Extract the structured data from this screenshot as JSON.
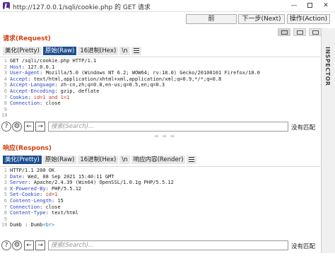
{
  "window": {
    "title": "http://127.0.0.1/sqli/cookie.php 的 GET 请求",
    "min_label": "—",
    "max_label": "",
    "close_label": "✕"
  },
  "nav": {
    "prev_label": "前",
    "next_label": "下一步(Next)",
    "action_label": "操作(Action)"
  },
  "inspector": {
    "label": "INSPECTOR"
  },
  "request": {
    "title": "请求(Request)",
    "tabs": [
      "美化(Pretty)",
      "原始(Raw)",
      "16进制(Hex)",
      "\\n"
    ],
    "active_tab": 1,
    "lines": [
      {
        "n": "1",
        "parts": [
          [
            "v",
            "GET /sqli/cookie.php HTTP/1.1"
          ]
        ]
      },
      {
        "n": "2",
        "parts": [
          [
            "k",
            "Host"
          ],
          [
            "v",
            ": 127.0.0.1"
          ]
        ]
      },
      {
        "n": "3",
        "parts": [
          [
            "k",
            "User-Agent"
          ],
          [
            "v",
            ": Mozilla/5.0 (Windows NT 6.2; WOW64; rv:18.0) Gecko/20100101 Firefox/18.0"
          ]
        ]
      },
      {
        "n": "4",
        "parts": [
          [
            "k",
            "Accept"
          ],
          [
            "v",
            ": text/html,application/xhtml+xml,application/xml;q=0.9,*/*;q=0.8"
          ]
        ]
      },
      {
        "n": "5",
        "parts": [
          [
            "k",
            "Accept-Language"
          ],
          [
            "v",
            ": zh-cn,zh;q=0.8,en-us;q=0.5,en;q=0.3"
          ]
        ]
      },
      {
        "n": "6",
        "parts": [
          [
            "k",
            "Accept-Encoding"
          ],
          [
            "v",
            ": gzip, deflate"
          ]
        ]
      },
      {
        "n": "7",
        "parts": [
          [
            "k",
            "Cookie"
          ],
          [
            "v",
            ": "
          ],
          [
            "r",
            "id=1 and 1=1"
          ]
        ]
      },
      {
        "n": "8",
        "parts": [
          [
            "k",
            "Connection"
          ],
          [
            "v",
            ": close"
          ]
        ]
      },
      {
        "n": "9",
        "parts": []
      },
      {
        "n": "10",
        "parts": []
      }
    ],
    "search_placeholder": "搜索(Search)...",
    "match_label": "没有匹配"
  },
  "response": {
    "title": "响应(Respons)",
    "tabs": [
      "美化(Pretty)",
      "原始(Raw)",
      "16进制(Hex)",
      "\\n",
      "响应内容(Render)"
    ],
    "active_tab": 0,
    "lines": [
      {
        "n": "1",
        "parts": [
          [
            "v",
            "HTTP/1.1 200 OK"
          ]
        ]
      },
      {
        "n": "2",
        "parts": [
          [
            "k",
            "Date"
          ],
          [
            "v",
            ": Wed, 08 Sep 2021 15:40:11 GMT"
          ]
        ]
      },
      {
        "n": "3",
        "parts": [
          [
            "k",
            "Server"
          ],
          [
            "v",
            ": Apache/2.4.39 (Win64) OpenSSL/1.0.1g PHP/5.5.12"
          ]
        ]
      },
      {
        "n": "4",
        "parts": [
          [
            "k",
            "X-Powered-By"
          ],
          [
            "v",
            ": PHP/5.5.12"
          ]
        ]
      },
      {
        "n": "5",
        "parts": [
          [
            "k",
            "Set-Cookie"
          ],
          [
            "v",
            ": "
          ],
          [
            "r",
            "id=1"
          ]
        ]
      },
      {
        "n": "6",
        "parts": [
          [
            "k",
            "Content-Length"
          ],
          [
            "v",
            ": 15"
          ]
        ]
      },
      {
        "n": "7",
        "parts": [
          [
            "k",
            "Connection"
          ],
          [
            "v",
            ": close"
          ]
        ]
      },
      {
        "n": "8",
        "parts": [
          [
            "k",
            "Content-Type"
          ],
          [
            "v",
            ": text/html"
          ]
        ]
      },
      {
        "n": "9",
        "parts": []
      },
      {
        "n": "10",
        "parts": [
          [
            "v",
            "Dumb : Dumb"
          ],
          [
            "t",
            "<br>"
          ]
        ]
      }
    ],
    "search_placeholder": "搜索(Search)...",
    "match_label": "没有匹配"
  },
  "divider": "= = =",
  "colors": {
    "accent_tab": "#1f4f8f",
    "section_title": "#d04010",
    "header_key": "#2a3fbf",
    "payload": "#c0392b",
    "html_tag": "#1a7ec1"
  },
  "icons": {
    "help": "help-icon",
    "settings": "gear-icon",
    "back": "arrow-left-icon",
    "forward": "arrow-right-icon",
    "menu": "hamburger-menu-icon"
  }
}
